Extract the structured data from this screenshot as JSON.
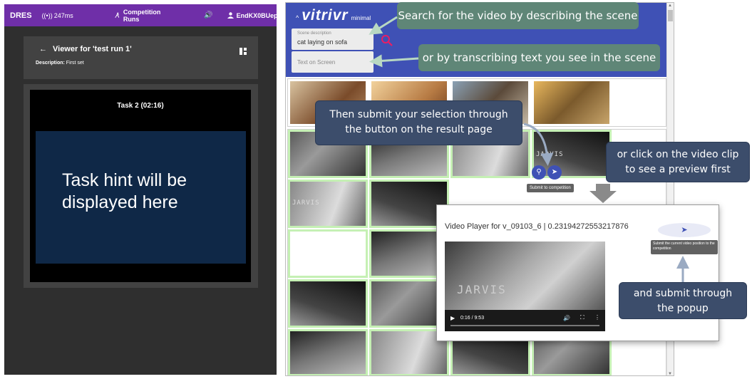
{
  "dres": {
    "brand": "DRES",
    "ping": "247ms",
    "nav_label": "Competition Runs",
    "user": "EndKX0BUep",
    "viewer_title": "Viewer for 'test run 1'",
    "description_label": "Description:",
    "description_value": "First set",
    "task_title": "Task 2 (02:16)",
    "task_hint": "Task hint will be displayed here",
    "colors": {
      "topbar": "#6f2fa8",
      "background": "#2f2f2f",
      "task_panel": "#0f2847"
    }
  },
  "vitrivr": {
    "brand_caret": "^",
    "logo": "vitrivr",
    "logo_suffix": "minimal",
    "scene_description_label": "Scene description",
    "scene_description_value": "cat laying on sofa",
    "text_on_screen_placeholder": "Text on Screen",
    "tile_overlay_text": "JARVIS",
    "submit_tooltip": "Submit to competition",
    "colors": {
      "header": "#3f51b5",
      "highlight": "#c5f0b4",
      "search_icon": "#e91e63"
    }
  },
  "player": {
    "title": "Video Player for v_09103_6 | 0.23194272553217876",
    "overlay_text": "JARVIS",
    "time": "0:16 / 9:53",
    "submit_tooltip": "Submit the current video position to the competition"
  },
  "callouts": {
    "search": "Search for the video by describing the scene",
    "transcribe": "or by transcribing text you see in the scene",
    "submit": "Then submit your selection through the button on the result page",
    "preview": "or click on the video clip to see a preview first",
    "popup": "and submit through the popup"
  },
  "icons": {
    "ping": "wifi-icon",
    "nav": "runner-icon",
    "sound": "speaker-icon",
    "user": "person-icon",
    "back": "arrow-left-icon",
    "layout": "grid-icon",
    "search": "search-icon",
    "send": "send-icon"
  }
}
